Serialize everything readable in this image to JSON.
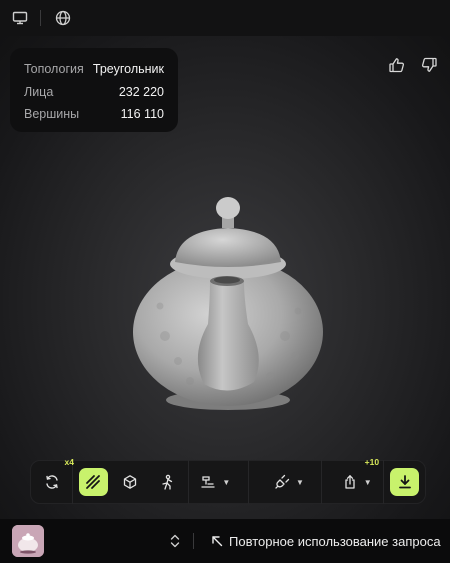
{
  "topbar": {
    "icons": [
      "desktop-icon",
      "globe-icon"
    ]
  },
  "info": {
    "rows": [
      {
        "key": "Топология",
        "value": "Треугольник"
      },
      {
        "key": "Лица",
        "value": "232 220"
      },
      {
        "key": "Вершины",
        "value": "116 110"
      }
    ]
  },
  "feedback": {
    "icons": [
      "thumbs-up-icon",
      "thumbs-down-icon"
    ]
  },
  "toolbar": {
    "regenerate_badge": "x4",
    "share_badge": "+10",
    "accent_color": "#c8f26c"
  },
  "bottom": {
    "reuse_label": "Повторное использование запроса"
  }
}
